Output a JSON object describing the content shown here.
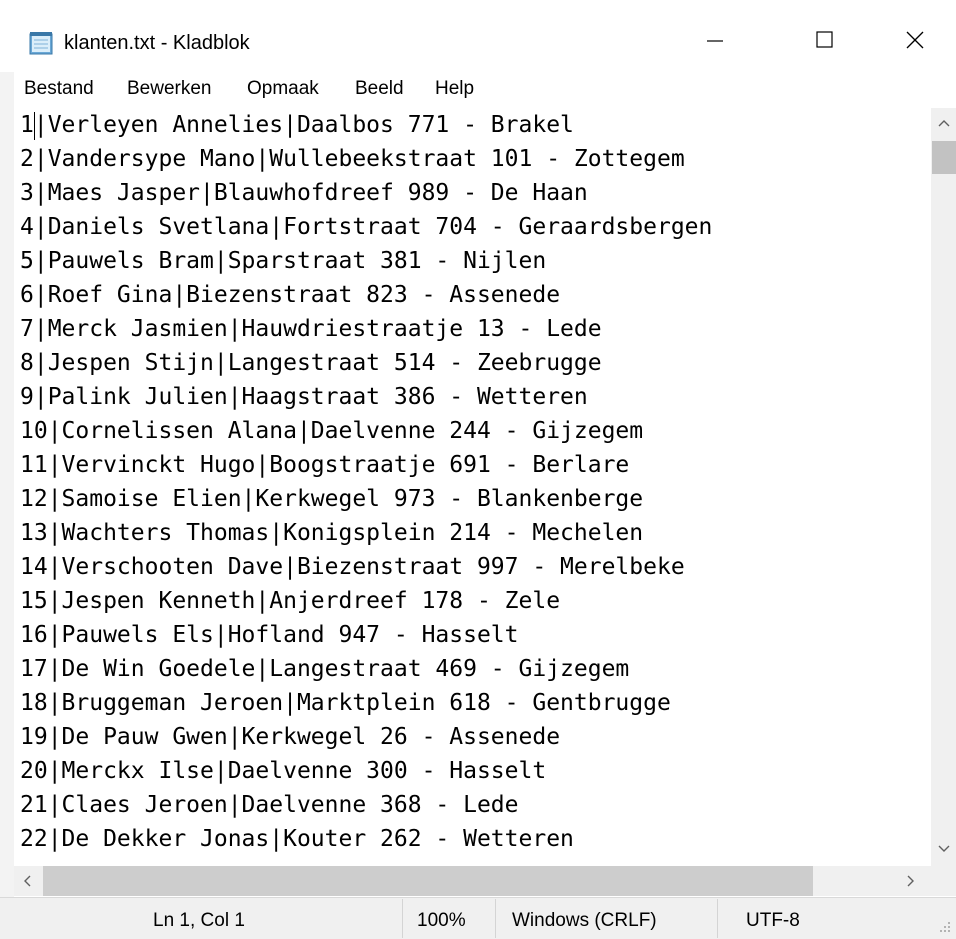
{
  "window": {
    "title": "klanten.txt - Kladblok",
    "controls": {
      "minimize": "—",
      "maximize": "☐",
      "close": "✕"
    }
  },
  "menu": [
    "Bestand",
    "Bewerken",
    "Opmaak",
    "Beeld",
    "Help"
  ],
  "editor": {
    "lines": [
      "1|Verleyen Annelies|Daalbos 771 - Brakel",
      "2|Vandersype Mano|Wullebeekstraat 101 - Zottegem",
      "3|Maes Jasper|Blauwhofdreef 989 - De Haan",
      "4|Daniels Svetlana|Fortstraat 704 - Geraardsbergen",
      "5|Pauwels Bram|Sparstraat 381 - Nijlen",
      "6|Roef Gina|Biezenstraat 823 - Assenede",
      "7|Merck Jasmien|Hauwdriestraatje 13 - Lede",
      "8|Jespen Stijn|Langestraat 514 - Zeebrugge",
      "9|Palink Julien|Haagstraat 386 - Wetteren",
      "10|Cornelissen Alana|Daelvenne 244 - Gijzegem",
      "11|Vervinckt Hugo|Boogstraatje 691 - Berlare",
      "12|Samoise Elien|Kerkwegel 973 - Blankenberge",
      "13|Wachters Thomas|Konigsplein 214 - Mechelen",
      "14|Verschooten Dave|Biezenstraat 997 - Merelbeke",
      "15|Jespen Kenneth|Anjerdreef 178 - Zele",
      "16|Pauwels Els|Hofland 947 - Hasselt",
      "17|De Win Goedele|Langestraat 469 - Gijzegem",
      "18|Bruggeman Jeroen|Marktplein 618 - Gentbrugge",
      "19|De Pauw Gwen|Kerkwegel 26 - Assenede",
      "20|Merckx Ilse|Daelvenne 300 - Hasselt",
      "21|Claes Jeroen|Daelvenne 368 - Lede",
      "22|De Dekker Jonas|Kouter 262 - Wetteren"
    ]
  },
  "status": {
    "position": "Ln 1, Col 1",
    "zoom": "100%",
    "line_endings": "Windows (CRLF)",
    "encoding": "UTF-8"
  },
  "scroll": {
    "up": "^",
    "down": "v",
    "left": "<",
    "right": ">"
  },
  "icons": [
    "notepad-icon",
    "minimize-icon",
    "maximize-icon",
    "close-icon"
  ]
}
